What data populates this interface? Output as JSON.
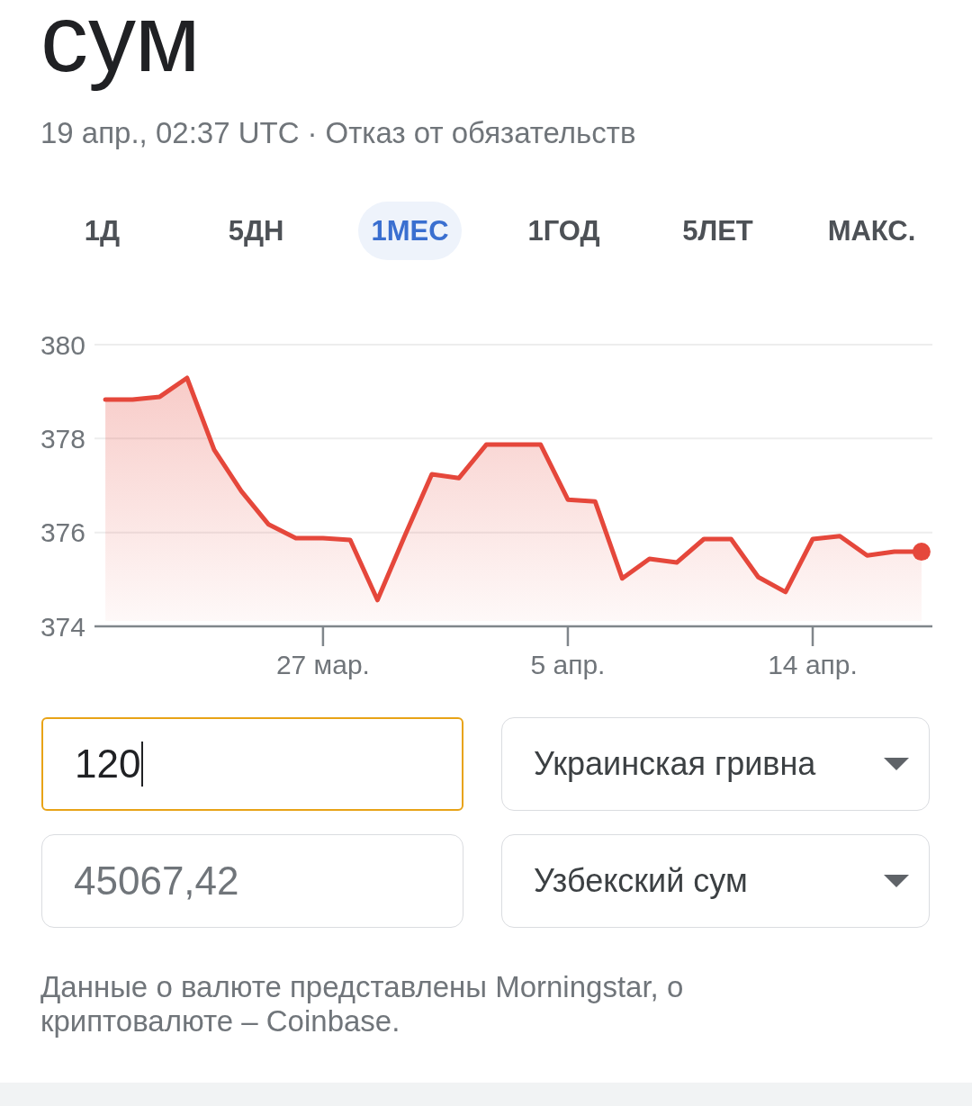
{
  "header": {
    "title": "сум",
    "timestamp": "19 апр., 02:37 UTC",
    "separator": "·",
    "disclaimer": "Отказ от обязательств"
  },
  "range_tabs": [
    {
      "label": "1Д",
      "selected": false
    },
    {
      "label": "5ДН",
      "selected": false
    },
    {
      "label": "1МЕС",
      "selected": true
    },
    {
      "label": "1ГОД",
      "selected": false
    },
    {
      "label": "5ЛЕТ",
      "selected": false
    },
    {
      "label": "МАКС.",
      "selected": false
    }
  ],
  "chart": {
    "chart_data": {
      "type": "area",
      "categories": [
        null,
        null,
        null,
        null,
        null,
        null,
        null,
        null,
        "27 мар.",
        null,
        null,
        null,
        null,
        null,
        null,
        null,
        null,
        "5 апр.",
        null,
        null,
        null,
        null,
        null,
        null,
        null,
        null,
        "14 апр.",
        null,
        null,
        null,
        null
      ],
      "series": [
        {
          "color": "#e5473b",
          "values": [
            378.83,
            378.83,
            378.89,
            379.29,
            377.76,
            376.88,
            376.17,
            375.88,
            375.88,
            375.84,
            374.56,
            375.92,
            377.24,
            377.16,
            377.87,
            377.87,
            377.87,
            376.7,
            376.66,
            375.02,
            375.44,
            375.36,
            375.86,
            375.86,
            375.05,
            374.73,
            375.86,
            375.92,
            375.51,
            375.59,
            375.59
          ]
        }
      ],
      "ylim": [
        374,
        380
      ],
      "yticks": [
        374,
        376,
        378,
        380
      ]
    }
  },
  "converter": {
    "rows": [
      {
        "amount": "120",
        "focused": true,
        "currency": "Украинская гривна"
      },
      {
        "amount": "45067,42",
        "focused": false,
        "currency": "Узбекский сум"
      }
    ]
  },
  "attribution": "Данные о валюте представлены Morningstar, о криптовалюте – Coinbase."
}
